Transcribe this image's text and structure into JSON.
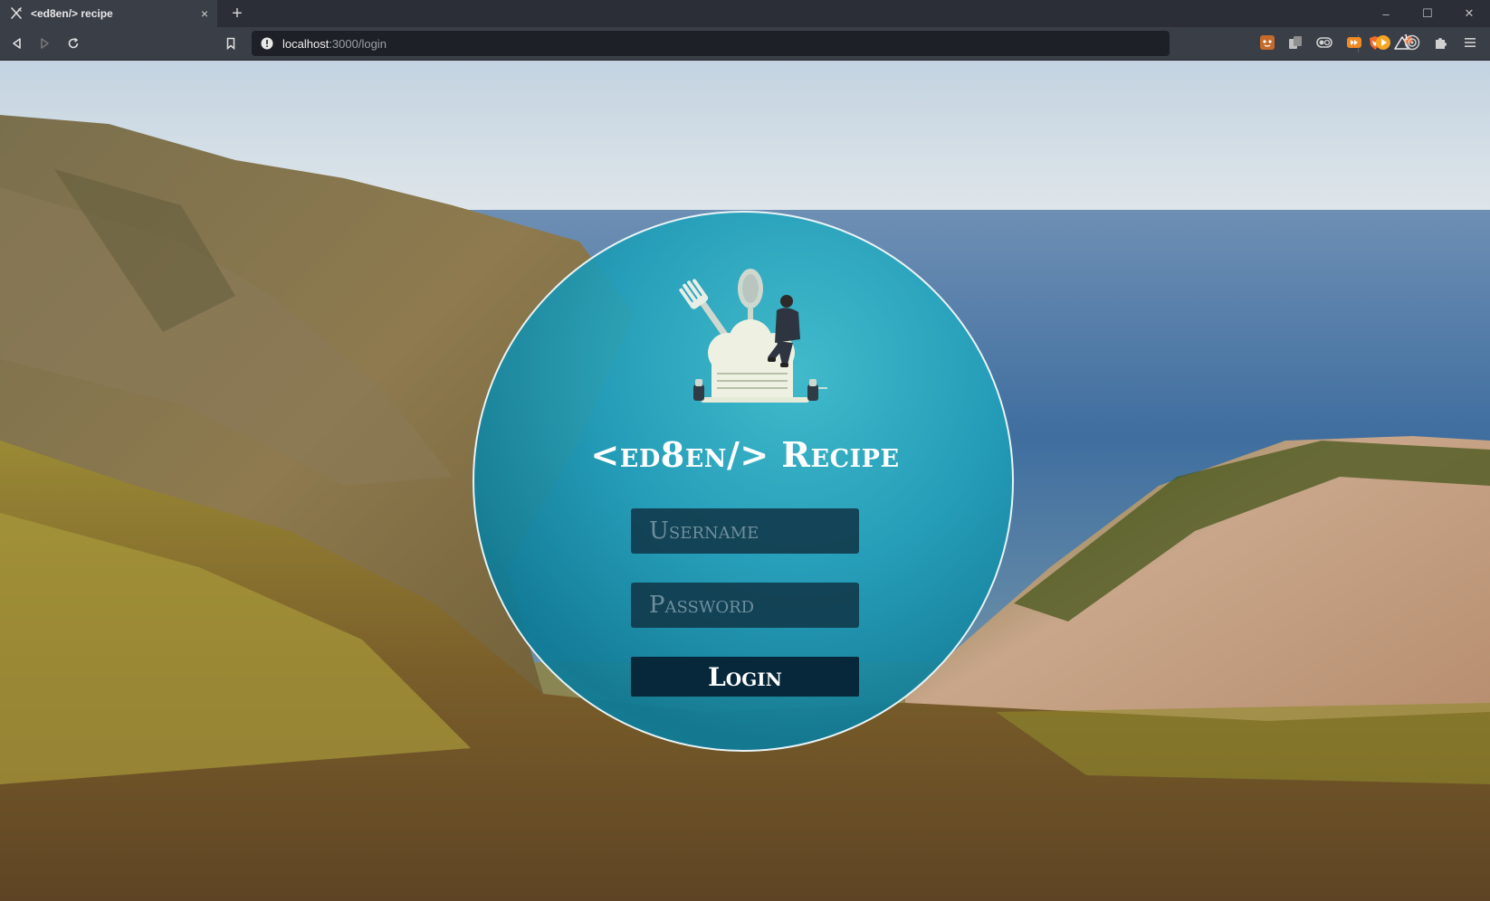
{
  "browser": {
    "tab_title": "<ed8en/> recipe",
    "tab_close": "×",
    "new_tab": "+",
    "url_host": "localhost",
    "url_path": ":3000/login",
    "window_controls": {
      "minimize": "–",
      "maximize": "☐",
      "close": "✕"
    },
    "brave_shields_badge": "1"
  },
  "login": {
    "brand_title": "<ed8en/> Recipe",
    "username_placeholder": "Username",
    "password_placeholder": "Password",
    "login_button": "Login"
  },
  "colors": {
    "circle_border": "#e8f4f6",
    "field_bg": "#103446",
    "button_bg": "#06283a",
    "toolbar": "#3a3e47",
    "titlebar": "#2b2e36"
  }
}
